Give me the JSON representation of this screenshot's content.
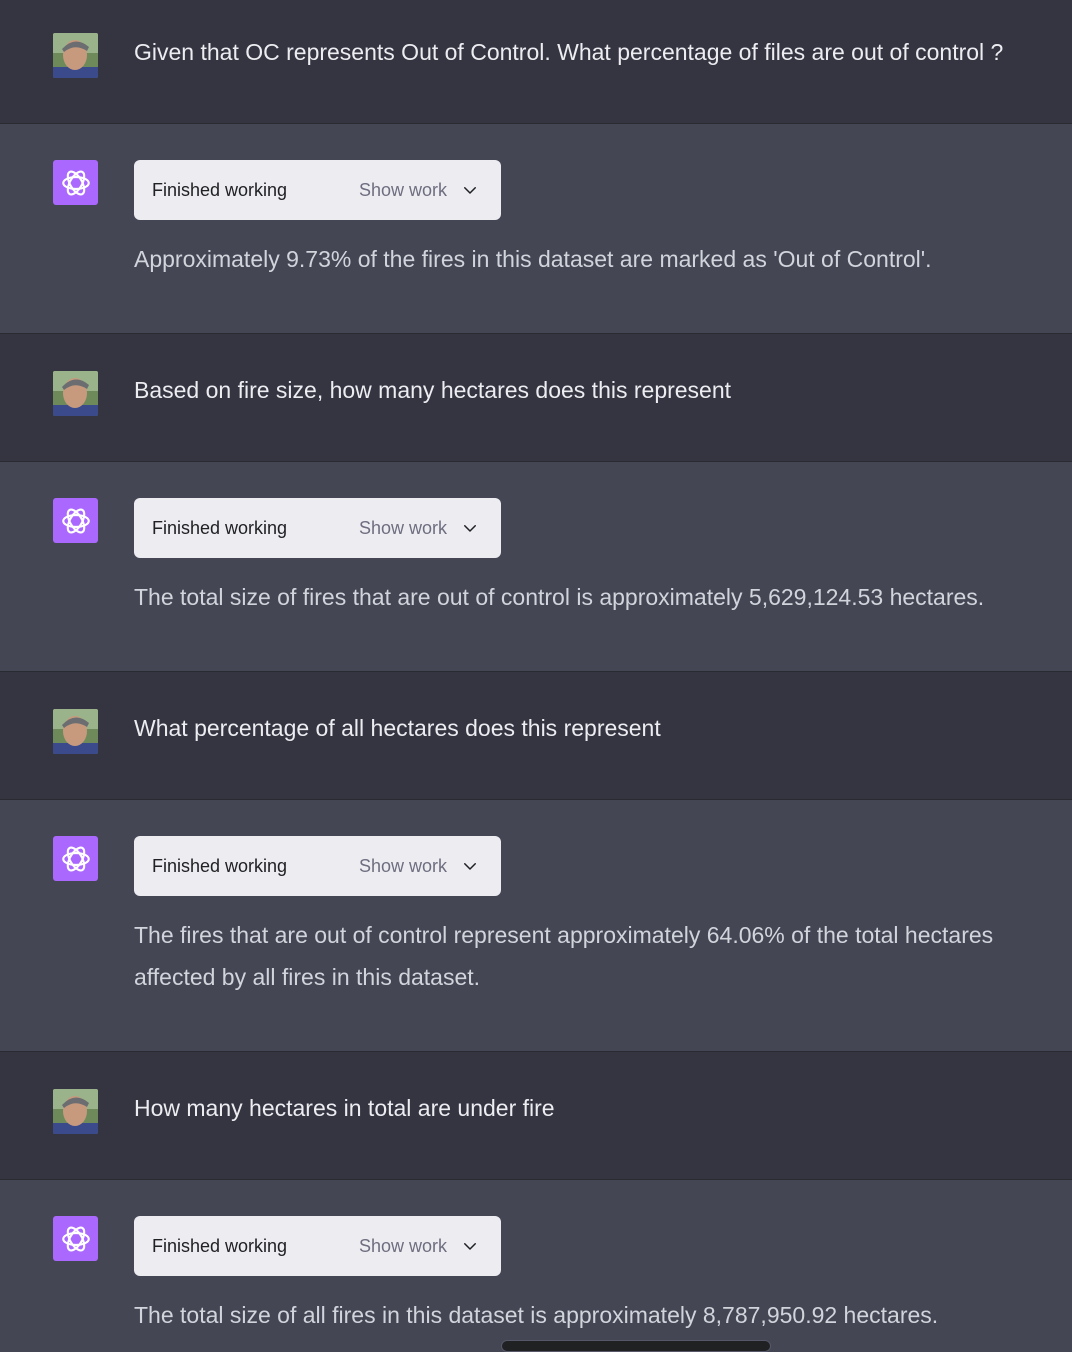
{
  "conversation": [
    {
      "role": "user",
      "text": "Given that OC represents Out of Control. What percentage of files are out of control ?"
    },
    {
      "role": "assistant",
      "status": "Finished working",
      "toggle": "Show work",
      "reply": "Approximately 9.73% of the fires in this dataset are marked as 'Out of Control'."
    },
    {
      "role": "user",
      "text": "Based on fire size, how many hectares does this represent"
    },
    {
      "role": "assistant",
      "status": "Finished working",
      "toggle": "Show work",
      "reply": "The total size of fires that are out of control is approximately 5,629,124.53 hectares."
    },
    {
      "role": "user",
      "text": "What percentage of all hectares does this represent"
    },
    {
      "role": "assistant",
      "status": "Finished working",
      "toggle": "Show work",
      "reply": "The fires that are out of control represent approximately 64.06% of the total hectares affected by all fires in this dataset."
    },
    {
      "role": "user",
      "text": "How many hectares in total are under fire"
    },
    {
      "role": "assistant",
      "status": "Finished working",
      "toggle": "Show work",
      "reply": "The total size of all fires in this dataset is approximately 8,787,950.92 hectares."
    }
  ],
  "icons": {
    "user_avatar": "user-photo-avatar",
    "assistant_avatar": "openai-logo-icon",
    "toggle": "chevron-down-icon"
  },
  "colors": {
    "user_bg": "#343541",
    "assistant_bg": "#444654",
    "assistant_avatar_bg": "#ab68ff",
    "work_box_bg": "#ececf1"
  }
}
